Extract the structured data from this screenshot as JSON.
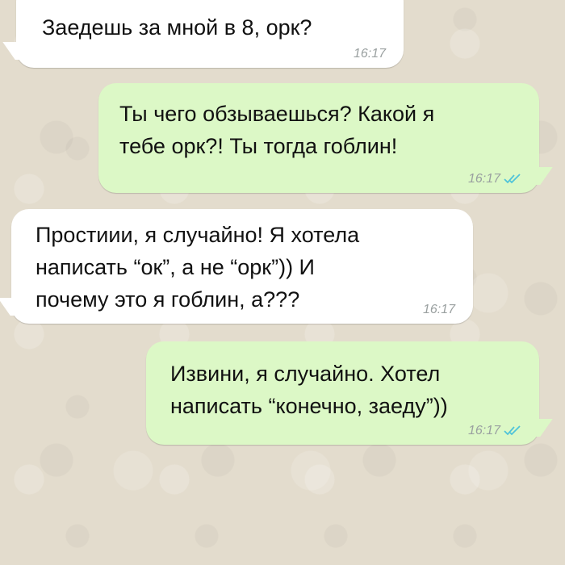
{
  "conversation": {
    "messages": [
      {
        "direction": "incoming",
        "text": "Заедешь за мной в 8, орк?",
        "time": "16:17"
      },
      {
        "direction": "outgoing",
        "text": "Ты чего обзываешься? Какой я\nтебе орк?! Ты тогда гоблин!",
        "time": "16:17",
        "status": "read"
      },
      {
        "direction": "incoming",
        "text": "Простиии, я случайно! Я хотела\nнаписать “ок”, а не “орк”)) И\nпочему это я гоблин, а???",
        "time": "16:17"
      },
      {
        "direction": "outgoing",
        "text": "Извини, я случайно. Хотел\nнаписать “конечно, заеду”))",
        "time": "16:17",
        "status": "read"
      }
    ]
  },
  "colors": {
    "background": "#e3dccd",
    "incoming_bubble": "#ffffff",
    "outgoing_bubble": "#dcf8c6",
    "read_check": "#4fc3d9"
  }
}
